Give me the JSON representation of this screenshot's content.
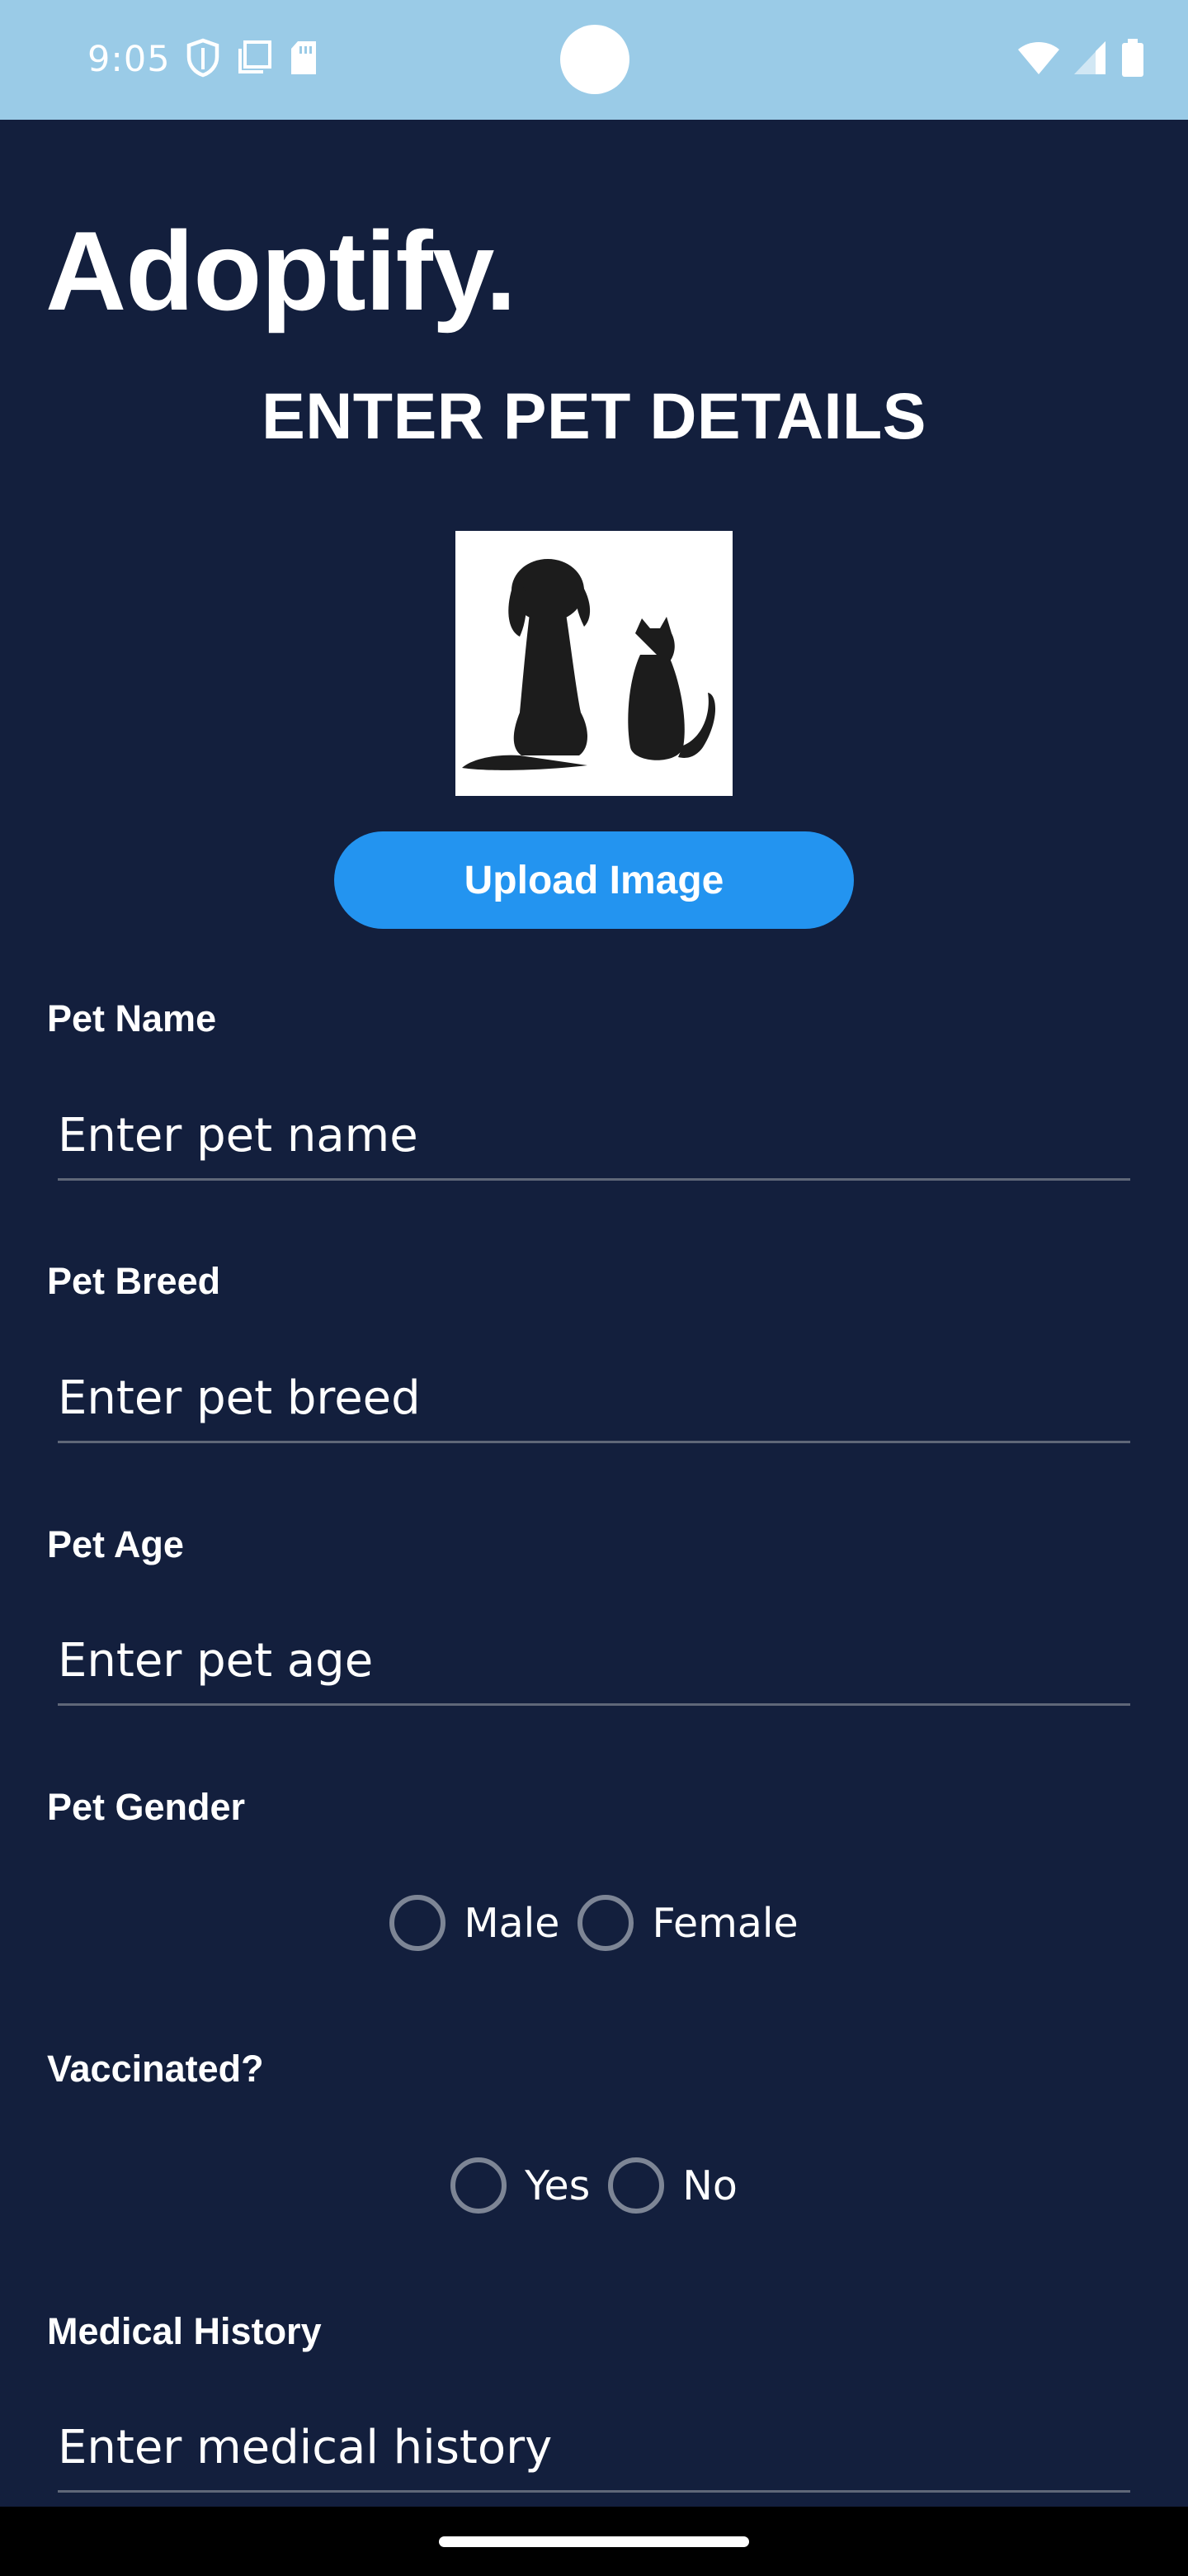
{
  "status_bar": {
    "time": "9:05",
    "icons_left": [
      "shield-icon",
      "screen-copy-icon",
      "sd-card-icon"
    ],
    "icons_right": [
      "wifi-icon",
      "cell-signal-icon",
      "battery-icon"
    ],
    "background": "#9acbe7"
  },
  "app": {
    "title": "Adoptify.",
    "heading": "ENTER PET DETAILS",
    "image_icon": "dog-and-cat-silhouette-icon",
    "upload_button_label": "Upload Image",
    "background": "#131f3d",
    "accent": "#2394f0"
  },
  "form": {
    "pet_name": {
      "label": "Pet Name",
      "placeholder": "Enter pet name"
    },
    "pet_breed": {
      "label": "Pet Breed",
      "placeholder": "Enter pet breed"
    },
    "pet_age": {
      "label": "Pet Age",
      "placeholder": "Enter pet age"
    },
    "pet_gender": {
      "label": "Pet Gender",
      "options": [
        "Male",
        "Female"
      ]
    },
    "vaccinated": {
      "label": "Vaccinated?",
      "options": [
        "Yes",
        "No"
      ]
    },
    "medical_history": {
      "label": "Medical History",
      "placeholder": "Enter medical history"
    }
  }
}
